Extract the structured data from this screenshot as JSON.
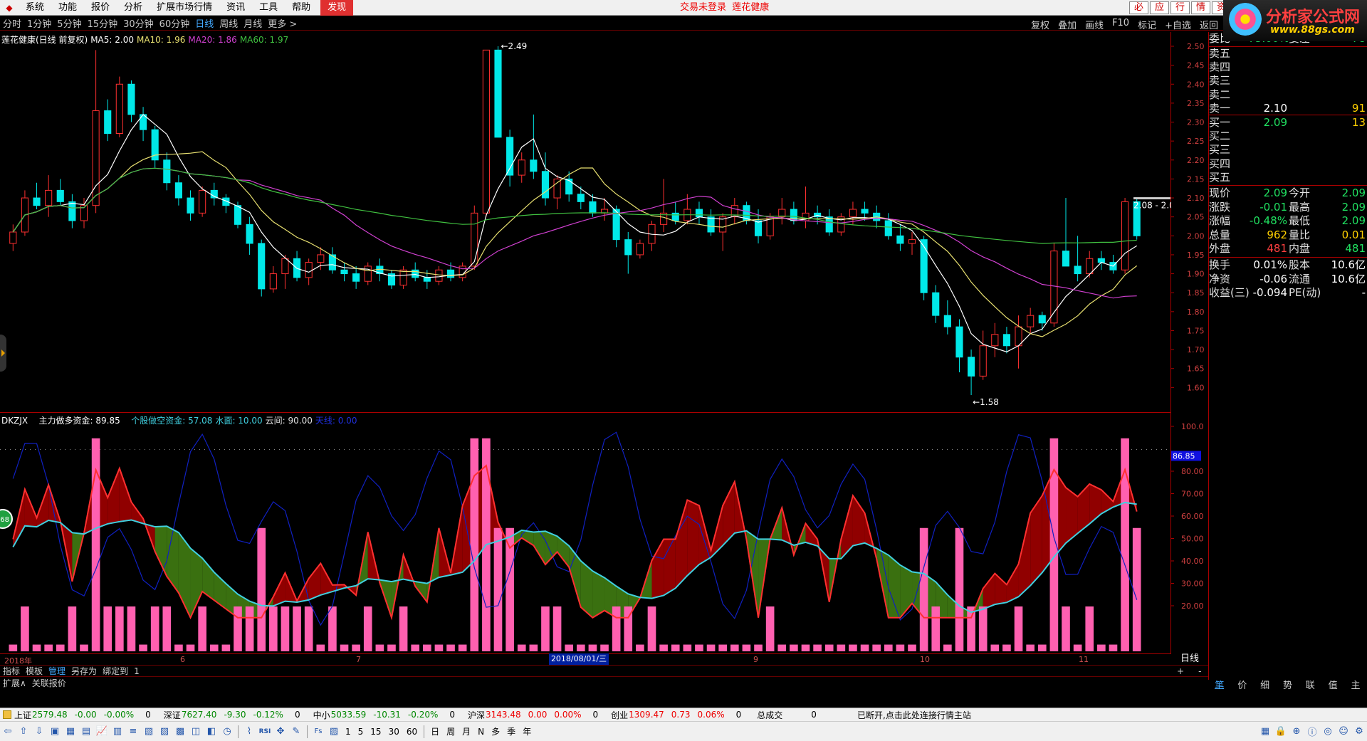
{
  "menu": {
    "items": [
      "系统",
      "功能",
      "报价",
      "分析",
      "扩展市场行情",
      "资讯",
      "工具",
      "帮助"
    ],
    "active": "发现",
    "login_status": "交易未登录",
    "stock_name": "莲花健康",
    "right_buttons": [
      "必",
      "应",
      "行",
      "情",
      "资"
    ]
  },
  "brand": {
    "title": "分析家公式网",
    "url": "www.88gs.com"
  },
  "periods": [
    "分时",
    "1分钟",
    "5分钟",
    "15分钟",
    "30分钟",
    "60分钟",
    "日线",
    "周线",
    "月线",
    "更多 >"
  ],
  "periods_selected": "日线",
  "toolbar_right": [
    "复权",
    "叠加",
    "画线",
    "F10",
    "标记",
    "+自选",
    "返回"
  ],
  "main_legend": {
    "title": "莲花健康(日线 前复权)",
    "ma5": "MA5: 2.00",
    "ma10": "MA10: 1.96",
    "ma20": "MA20: 1.86",
    "ma60": "MA60: 1.97",
    "high_label": "2.49",
    "low_label": "1.58",
    "last_label": "2.08 - 2.0"
  },
  "price_axis": [
    "2.50",
    "2.45",
    "2.40",
    "2.35",
    "2.30",
    "2.25",
    "2.20",
    "2.15",
    "2.10",
    "2.05",
    "2.00",
    "1.95",
    "1.90",
    "1.85",
    "1.80",
    "1.75",
    "1.70",
    "1.65",
    "1.60"
  ],
  "sub_legend": {
    "name": "DKZJX",
    "a": "主力做多资金: 89.85",
    "b": "个股做空资金: 57.08",
    "c": "水面: 10.00",
    "d": "云间: 90.00",
    "e": "天线: 0.00"
  },
  "sub_axis": [
    "100.0",
    "86.85",
    "80.00",
    "70.00",
    "60.00",
    "50.00",
    "40.00",
    "30.00",
    "20.00"
  ],
  "time_axis": [
    "2018年",
    "6",
    "7",
    "8",
    "9",
    "10",
    "11"
  ],
  "date_box": "2018/08/01/三",
  "period_label": "日线",
  "bottom_tabs": [
    "指标",
    "模板",
    "管理",
    "另存为",
    "绑定到",
    "1"
  ],
  "bottom_tabs_selected": "管理",
  "ext_tabs": [
    "扩展∧",
    "关联报价"
  ],
  "quote_tabs": [
    "笔",
    "价",
    "细",
    "势",
    "联",
    "值",
    "主"
  ],
  "quote_tabs_selected": "笔",
  "quote": {
    "weibi": {
      "label": "委比",
      "value": "-75.00%",
      "label2": "委差",
      "value2": "-78"
    },
    "sells": [
      {
        "label": "卖五",
        "price": "",
        "vol": ""
      },
      {
        "label": "卖四",
        "price": "",
        "vol": ""
      },
      {
        "label": "卖三",
        "price": "",
        "vol": ""
      },
      {
        "label": "卖二",
        "price": "",
        "vol": ""
      },
      {
        "label": "卖一",
        "price": "2.10",
        "vol": "91"
      }
    ],
    "buys": [
      {
        "label": "买一",
        "price": "2.09",
        "vol": "13"
      },
      {
        "label": "买二",
        "price": "",
        "vol": ""
      },
      {
        "label": "买三",
        "price": "",
        "vol": ""
      },
      {
        "label": "买四",
        "price": "",
        "vol": ""
      },
      {
        "label": "买五",
        "price": "",
        "vol": ""
      }
    ],
    "stats": [
      {
        "l": "现价",
        "v": "2.09",
        "l2": "今开",
        "v2": "2.09",
        "c1": "#20e060",
        "c2": "#20e060"
      },
      {
        "l": "涨跌",
        "v": "-0.01",
        "l2": "最高",
        "v2": "2.09",
        "c1": "#20e060",
        "c2": "#20e060"
      },
      {
        "l": "涨幅",
        "v": "-0.48%",
        "l2": "最低",
        "v2": "2.09",
        "c1": "#20e060",
        "c2": "#20e060"
      },
      {
        "l": "总量",
        "v": "962",
        "l2": "量比",
        "v2": "0.01",
        "c1": "#ffd000",
        "c2": "#ffd000"
      },
      {
        "l": "外盘",
        "v": "481",
        "l2": "内盘",
        "v2": "481",
        "c1": "#ff4040",
        "c2": "#20e060"
      }
    ],
    "stats2": [
      {
        "l": "换手",
        "v": "0.01%",
        "l2": "股本",
        "v2": "10.6亿"
      },
      {
        "l": "净资",
        "v": "-0.06",
        "l2": "流通",
        "v2": "10.6亿"
      },
      {
        "l": "收益(三)",
        "v": "-0.094",
        "l2": "PE(动)",
        "v2": "-"
      }
    ]
  },
  "status": {
    "indices": [
      {
        "name": "上证",
        "value": "2579.48",
        "change": "-0.00",
        "pct": "-0.00%",
        "vol": "0",
        "color": "#080"
      },
      {
        "name": "深证",
        "value": "7627.40",
        "change": "-9.30",
        "pct": "-0.12%",
        "vol": "0",
        "color": "#080"
      },
      {
        "name": "中小",
        "value": "5033.59",
        "change": "-10.31",
        "pct": "-0.20%",
        "vol": "0",
        "color": "#080"
      },
      {
        "name": "沪深",
        "value": "3143.48",
        "change": "0.00",
        "pct": "0.00%",
        "vol": "0",
        "color": "#e00"
      },
      {
        "name": "创业",
        "value": "1309.47",
        "change": "0.73",
        "pct": "0.06%",
        "vol": "0",
        "color": "#e00"
      }
    ],
    "total_label": "总成交",
    "total_value": "0",
    "message": "已断开,点击此处连接行情主站"
  },
  "iconbar_text": [
    "1",
    "5",
    "15",
    "30",
    "60",
    "日",
    "周",
    "月",
    "N",
    "多",
    "季",
    "年"
  ],
  "colors": {
    "up": "#ff3030",
    "down": "#00e8e8",
    "ma5": "#ffffff",
    "ma10": "#e8e070",
    "ma20": "#d040d0",
    "ma60": "#40c040",
    "bull_fill": "#900000",
    "bear_fill": "#3a7010",
    "pink": "#ff60b0",
    "blueline": "#1020c0",
    "cyanline": "#40d0e0"
  },
  "chart_data": {
    "type": "candlestick",
    "title": "莲花健康(日线 前复权)",
    "ylim": [
      1.58,
      2.5
    ],
    "ohlc": [
      [
        1.98,
        2.03,
        1.96,
        2.01
      ],
      [
        2.01,
        2.12,
        2.0,
        2.1
      ],
      [
        2.1,
        2.14,
        2.07,
        2.08
      ],
      [
        2.08,
        2.16,
        2.05,
        2.12
      ],
      [
        2.12,
        2.15,
        2.08,
        2.09
      ],
      [
        2.09,
        2.11,
        2.02,
        2.04
      ],
      [
        2.04,
        2.1,
        2.02,
        2.08
      ],
      [
        2.08,
        2.49,
        2.06,
        2.33
      ],
      [
        2.33,
        2.36,
        2.25,
        2.27
      ],
      [
        2.27,
        2.42,
        2.26,
        2.4
      ],
      [
        2.4,
        2.41,
        2.3,
        2.32
      ],
      [
        2.32,
        2.34,
        2.25,
        2.28
      ],
      [
        2.28,
        2.29,
        2.18,
        2.2
      ],
      [
        2.2,
        2.22,
        2.12,
        2.14
      ],
      [
        2.14,
        2.16,
        2.08,
        2.1
      ],
      [
        2.1,
        2.12,
        2.04,
        2.06
      ],
      [
        2.06,
        2.13,
        2.05,
        2.12
      ],
      [
        2.12,
        2.14,
        2.08,
        2.1
      ],
      [
        2.1,
        2.11,
        2.06,
        2.08
      ],
      [
        2.08,
        2.09,
        2.02,
        2.03
      ],
      [
        2.03,
        2.05,
        1.95,
        1.98
      ],
      [
        1.98,
        1.99,
        1.84,
        1.86
      ],
      [
        1.86,
        1.92,
        1.85,
        1.9
      ],
      [
        1.9,
        1.95,
        1.86,
        1.94
      ],
      [
        1.94,
        1.96,
        1.88,
        1.89
      ],
      [
        1.89,
        1.94,
        1.87,
        1.93
      ],
      [
        1.93,
        1.97,
        1.91,
        1.95
      ],
      [
        1.95,
        1.97,
        1.9,
        1.91
      ],
      [
        1.91,
        1.93,
        1.88,
        1.9
      ],
      [
        1.9,
        1.92,
        1.86,
        1.88
      ],
      [
        1.88,
        1.93,
        1.87,
        1.92
      ],
      [
        1.92,
        1.94,
        1.88,
        1.9
      ],
      [
        1.9,
        1.91,
        1.86,
        1.87
      ],
      [
        1.87,
        1.92,
        1.86,
        1.91
      ],
      [
        1.91,
        1.93,
        1.88,
        1.89
      ],
      [
        1.89,
        1.91,
        1.86,
        1.88
      ],
      [
        1.88,
        1.92,
        1.87,
        1.91
      ],
      [
        1.91,
        1.93,
        1.88,
        1.89
      ],
      [
        1.89,
        1.93,
        1.88,
        1.92
      ],
      [
        1.92,
        2.08,
        1.91,
        2.06
      ],
      [
        2.06,
        2.34,
        2.05,
        2.49
      ],
      [
        2.49,
        2.5,
        2.3,
        2.26
      ],
      [
        2.26,
        2.28,
        2.13,
        2.16
      ],
      [
        2.16,
        2.22,
        2.14,
        2.2
      ],
      [
        2.2,
        2.32,
        2.15,
        2.17
      ],
      [
        2.17,
        2.22,
        2.08,
        2.1
      ],
      [
        2.1,
        2.16,
        2.07,
        2.15
      ],
      [
        2.15,
        2.17,
        2.09,
        2.11
      ],
      [
        2.11,
        2.13,
        2.07,
        2.09
      ],
      [
        2.09,
        2.11,
        2.05,
        2.06
      ],
      [
        2.06,
        2.1,
        2.04,
        2.07
      ],
      [
        2.07,
        2.08,
        1.97,
        1.99
      ],
      [
        1.99,
        2.01,
        1.9,
        1.95
      ],
      [
        1.95,
        1.99,
        1.94,
        1.98
      ],
      [
        1.98,
        2.04,
        1.96,
        2.03
      ],
      [
        2.03,
        2.15,
        2.01,
        2.06
      ],
      [
        2.06,
        2.09,
        2.03,
        2.04
      ],
      [
        2.04,
        2.11,
        2.03,
        2.07
      ],
      [
        2.07,
        2.09,
        2.03,
        2.05
      ],
      [
        2.05,
        2.07,
        2.0,
        2.01
      ],
      [
        2.01,
        2.06,
        1.96,
        2.05
      ],
      [
        2.05,
        2.1,
        2.03,
        2.08
      ],
      [
        2.08,
        2.09,
        2.03,
        2.04
      ],
      [
        2.04,
        2.07,
        1.98,
        2.0
      ],
      [
        2.0,
        2.06,
        1.99,
        2.05
      ],
      [
        2.05,
        2.1,
        2.03,
        2.07
      ],
      [
        2.07,
        2.09,
        2.03,
        2.04
      ],
      [
        2.04,
        2.13,
        2.02,
        2.06
      ],
      [
        2.06,
        2.08,
        2.03,
        2.05
      ],
      [
        2.05,
        2.07,
        2.0,
        2.01
      ],
      [
        2.01,
        2.06,
        2.0,
        2.05
      ],
      [
        2.05,
        2.09,
        2.03,
        2.07
      ],
      [
        2.07,
        2.09,
        2.04,
        2.06
      ],
      [
        2.06,
        2.08,
        2.02,
        2.04
      ],
      [
        2.04,
        2.06,
        1.99,
        2.0
      ],
      [
        2.0,
        2.03,
        1.96,
        1.98
      ],
      [
        1.98,
        2.01,
        1.95,
        1.99
      ],
      [
        1.99,
        2.0,
        1.83,
        1.85
      ],
      [
        1.85,
        1.87,
        1.77,
        1.79
      ],
      [
        1.79,
        1.83,
        1.74,
        1.76
      ],
      [
        1.76,
        1.78,
        1.64,
        1.68
      ],
      [
        1.68,
        1.7,
        1.58,
        1.63
      ],
      [
        1.63,
        1.75,
        1.62,
        1.71
      ],
      [
        1.71,
        1.77,
        1.68,
        1.74
      ],
      [
        1.74,
        1.76,
        1.69,
        1.71
      ],
      [
        1.71,
        1.79,
        1.65,
        1.76
      ],
      [
        1.76,
        1.81,
        1.74,
        1.79
      ],
      [
        1.79,
        1.8,
        1.75,
        1.77
      ],
      [
        1.77,
        1.98,
        1.76,
        1.96
      ],
      [
        1.96,
        2.1,
        1.95,
        1.92
      ],
      [
        1.92,
        2.0,
        1.88,
        1.9
      ],
      [
        1.9,
        1.96,
        1.89,
        1.94
      ],
      [
        1.94,
        1.96,
        1.91,
        1.93
      ],
      [
        1.93,
        1.95,
        1.9,
        1.91
      ],
      [
        1.91,
        2.1,
        1.9,
        2.09
      ],
      [
        2.09,
        2.1,
        1.99,
        2.0
      ]
    ]
  }
}
